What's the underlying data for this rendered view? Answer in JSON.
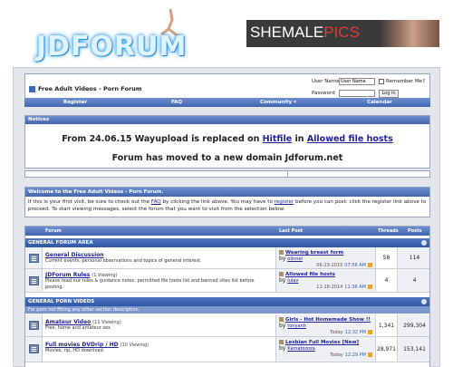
{
  "header": {
    "logo_text": "JDFORUM",
    "banner": {
      "text_main": "SHEMALE",
      "text_accent": "PICS",
      "accent_color": "#e23b3b"
    }
  },
  "navbox": {
    "title": "Free Adult Videos - Porn Forum",
    "login": {
      "username_label": "User Name",
      "username_value": "User Name",
      "remember_label": "Remember Me?",
      "password_label": "Password",
      "login_button": "Log in"
    }
  },
  "navbar": {
    "items": [
      "Register",
      "FAQ",
      "Community ▾",
      "Calendar"
    ]
  },
  "notices": {
    "header": "Notices",
    "line1_pre": "From 24.06.15 Wayupload is replaced on ",
    "line1_link1": "Hitfile",
    "line1_mid": " in ",
    "line1_link2": "Allowed file hosts",
    "line2": "Forum has moved to a new domain Jdforum.net"
  },
  "welcome": {
    "header": "Welcome to the Free Adult Videos - Porn Forum.",
    "body_pre": "If this is your first visit, be sure to check out the ",
    "faq_link": "FAQ",
    "body_mid": " by clicking the link above. You may have to ",
    "register_link": "register",
    "body_post": " before you can post: click the register link above to proceed. To start viewing messages, select the forum that you want to visit from the selection below."
  },
  "forum_table": {
    "columns": {
      "forum": "Forum",
      "last_post": "Last Post",
      "threads": "Threads",
      "posts": "Posts"
    },
    "categories": [
      {
        "name": "GENERAL FORUM AREA",
        "subtitle": "",
        "forums": [
          {
            "name": "General Discussion",
            "viewing": "",
            "desc": "Current events, personal observations and topics of general interest.",
            "last_title": "Wearing breast form",
            "last_by": "olinnel",
            "last_date": "06-23-2015",
            "last_time": "07:56 AM",
            "threads": "58",
            "posts": "114"
          },
          {
            "name": "JDForum Rules",
            "viewing": "(1 Viewing)",
            "desc": "Please read our rules & guidance notes, permitted file hosts list and banned sites list before posting.",
            "last_title": "Allowed file hosts",
            "last_by": "Iulav",
            "last_date": "11-18-2014",
            "last_time": "11:36 AM",
            "threads": "4",
            "posts": "4"
          }
        ]
      },
      {
        "name": "GENERAL PORN VIDEOS",
        "subtitle": "For porn not fitting any other section description",
        "forums": [
          {
            "name": "Amateur Video",
            "viewing": "(11 Viewing)",
            "desc": "Free, home and amateur sex",
            "last_title": "Girls - Hot Homemade Show !!",
            "last_by": "tonyanh",
            "last_date": "Today",
            "last_time": "12:32 PM",
            "threads": "1,341",
            "posts": "299,304"
          },
          {
            "name": "Full movies DVDrip / HD",
            "viewing": "(10 Viewing)",
            "desc": "Movies, rip, HD download",
            "last_title": "Lesbian Full Movies [New]",
            "last_by": "Kamatozoza",
            "last_date": "Today",
            "last_time": "12:29 PM",
            "threads": "28,971",
            "posts": "153,141"
          }
        ]
      }
    ]
  }
}
